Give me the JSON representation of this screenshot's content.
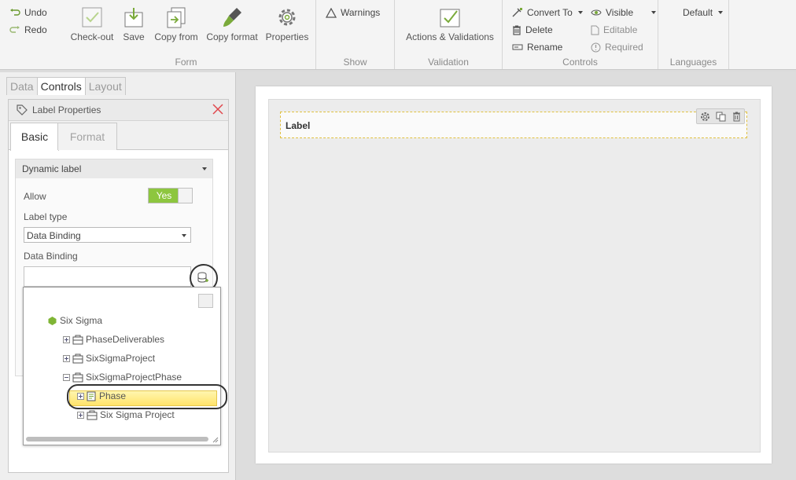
{
  "ribbon": {
    "undo": "Undo",
    "redo": "Redo",
    "form": {
      "label": "Form",
      "checkout": "Check-out",
      "save": "Save",
      "copy_from": "Copy from",
      "copy_format": "Copy format",
      "properties": "Properties"
    },
    "show": {
      "label": "Show",
      "warnings": "Warnings"
    },
    "validation": {
      "label": "Validation",
      "actions": "Actions & Validations"
    },
    "controls": {
      "label": "Controls",
      "convert_to": "Convert To",
      "delete": "Delete",
      "rename": "Rename",
      "visible": "Visible",
      "editable": "Editable",
      "required": "Required"
    },
    "languages": {
      "label": "Languages",
      "default": "Default"
    }
  },
  "left_tabs": [
    "Data",
    "Controls",
    "Layout"
  ],
  "properties": {
    "title": "Label Properties",
    "tabs": [
      "Basic",
      "Format"
    ],
    "section": "Dynamic label",
    "allow_label": "Allow",
    "allow_value": "Yes",
    "label_type_label": "Label type",
    "label_type_value": "Data Binding",
    "data_binding_label": "Data Binding"
  },
  "tree": {
    "root": "Six Sigma",
    "items": [
      "PhaseDeliverables",
      "SixSigmaProject",
      "SixSigmaProjectPhase",
      "Phase",
      "Six Sigma Project"
    ]
  },
  "canvas": {
    "label_text": "Label"
  },
  "colors": {
    "accent_green": "#8dc63f",
    "highlight": "#ffe36a",
    "close_red": "#e0474c"
  }
}
